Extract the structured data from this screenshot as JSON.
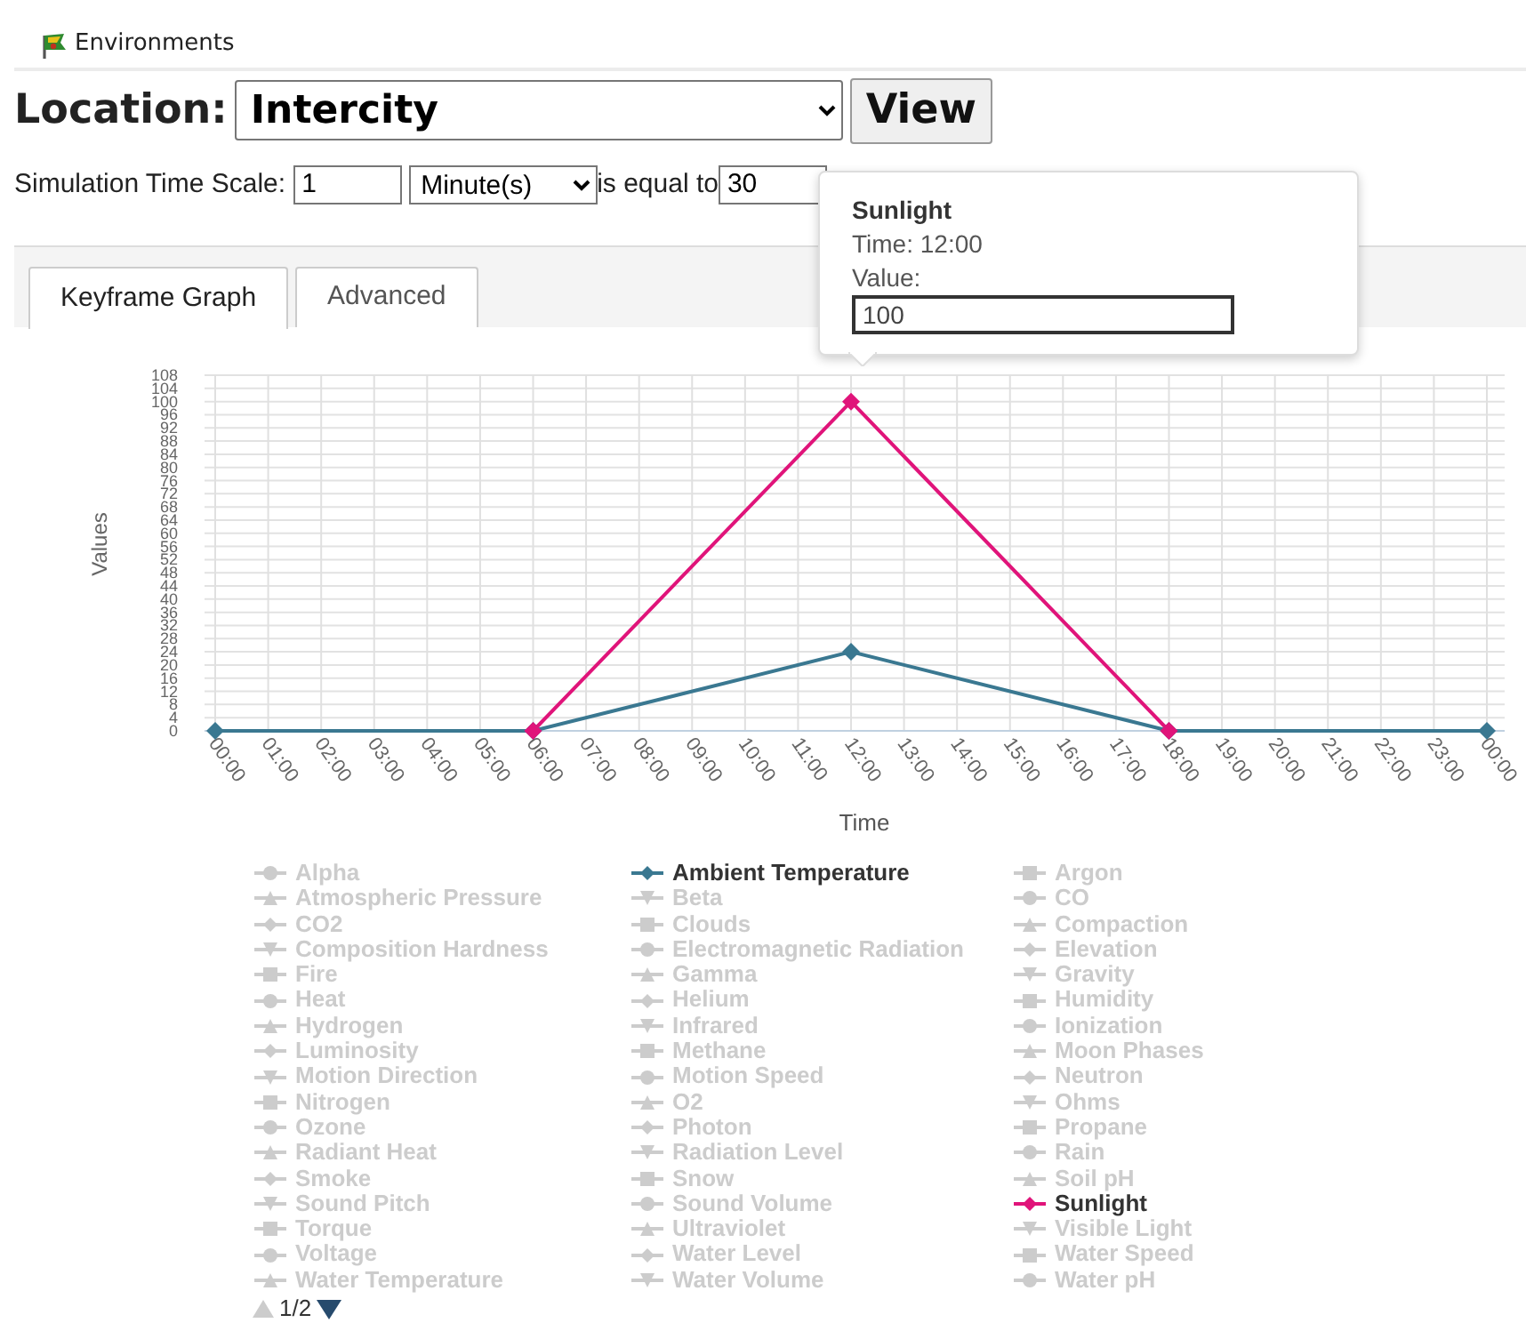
{
  "header": {
    "title": "Environments"
  },
  "location": {
    "label": "Location:",
    "value": "Intercity",
    "button": "View"
  },
  "time_scale": {
    "label": "Simulation Time Scale:",
    "amount": "1",
    "unit": "Minute(s)",
    "equals_label": "is equal to",
    "equals_value": "30"
  },
  "tabs": [
    {
      "label": "Keyframe Graph",
      "selected": true
    },
    {
      "label": "Advanced",
      "selected": false
    }
  ],
  "chart": {
    "chart_data": {
      "type": "line",
      "xlabel": "Time",
      "ylabel": "Values",
      "x": [
        0,
        6,
        12,
        18,
        24
      ],
      "grid": true,
      "series": [
        {
          "color": "#3a7891",
          "marker": "diamond",
          "values": [
            0,
            0,
            24,
            0,
            0
          ]
        },
        {
          "color": "#e0147a",
          "marker": "diamond",
          "values": [
            null,
            0,
            100,
            0,
            null
          ]
        }
      ],
      "xlim": [
        0,
        24
      ],
      "ylim": [
        0,
        108
      ],
      "xticks": [
        {
          "value": 0,
          "label": "00:00"
        },
        {
          "value": 1,
          "label": "01:00"
        },
        {
          "value": 2,
          "label": "02:00"
        },
        {
          "value": 3,
          "label": "03:00"
        },
        {
          "value": 4,
          "label": "04:00"
        },
        {
          "value": 5,
          "label": "05:00"
        },
        {
          "value": 6,
          "label": "06:00"
        },
        {
          "value": 7,
          "label": "07:00"
        },
        {
          "value": 8,
          "label": "08:00"
        },
        {
          "value": 9,
          "label": "09:00"
        },
        {
          "value": 10,
          "label": "10:00"
        },
        {
          "value": 11,
          "label": "11:00"
        },
        {
          "value": 12,
          "label": "12:00"
        },
        {
          "value": 13,
          "label": "13:00"
        },
        {
          "value": 14,
          "label": "14:00"
        },
        {
          "value": 15,
          "label": "15:00"
        },
        {
          "value": 16,
          "label": "16:00"
        },
        {
          "value": 17,
          "label": "17:00"
        },
        {
          "value": 18,
          "label": "18:00"
        },
        {
          "value": 19,
          "label": "19:00"
        },
        {
          "value": 20,
          "label": "20:00"
        },
        {
          "value": 21,
          "label": "21:00"
        },
        {
          "value": 22,
          "label": "22:00"
        },
        {
          "value": 23,
          "label": "23:00"
        },
        {
          "value": 24,
          "label": "00:00"
        }
      ],
      "yticks": [
        0,
        4,
        8,
        12,
        16,
        20,
        24,
        28,
        32,
        36,
        40,
        44,
        48,
        52,
        56,
        60,
        64,
        68,
        72,
        76,
        80,
        84,
        88,
        92,
        96,
        100,
        104,
        108
      ]
    }
  },
  "tooltip": {
    "title": "Sunlight",
    "time": "Time: 12:00",
    "value_label": "Value:",
    "value": "100"
  },
  "legend": {
    "items": [
      {
        "name": "Alpha",
        "kind": "circle",
        "visible": false
      },
      {
        "name": "Ambient Temperature",
        "kind": "diamond",
        "visible": true,
        "color": "#3a7891"
      },
      {
        "name": "Argon",
        "kind": "square",
        "visible": false
      },
      {
        "name": "Atmospheric Pressure",
        "kind": "triangle",
        "visible": false
      },
      {
        "name": "Beta",
        "kind": "triangledown",
        "visible": false
      },
      {
        "name": "CO",
        "kind": "circle",
        "visible": false
      },
      {
        "name": "CO2",
        "kind": "diamond",
        "visible": false
      },
      {
        "name": "Clouds",
        "kind": "square",
        "visible": false
      },
      {
        "name": "Compaction",
        "kind": "triangle",
        "visible": false
      },
      {
        "name": "Composition Hardness",
        "kind": "triangledown",
        "visible": false
      },
      {
        "name": "Electromagnetic Radiation",
        "kind": "circle",
        "visible": false
      },
      {
        "name": "Elevation",
        "kind": "diamond",
        "visible": false
      },
      {
        "name": "Fire",
        "kind": "square",
        "visible": false
      },
      {
        "name": "Gamma",
        "kind": "triangle",
        "visible": false
      },
      {
        "name": "Gravity",
        "kind": "triangledown",
        "visible": false
      },
      {
        "name": "Heat",
        "kind": "circle",
        "visible": false
      },
      {
        "name": "Helium",
        "kind": "diamond",
        "visible": false
      },
      {
        "name": "Humidity",
        "kind": "square",
        "visible": false
      },
      {
        "name": "Hydrogen",
        "kind": "triangle",
        "visible": false
      },
      {
        "name": "Infrared",
        "kind": "triangledown",
        "visible": false
      },
      {
        "name": "Ionization",
        "kind": "circle",
        "visible": false
      },
      {
        "name": "Luminosity",
        "kind": "diamond",
        "visible": false
      },
      {
        "name": "Methane",
        "kind": "square",
        "visible": false
      },
      {
        "name": "Moon Phases",
        "kind": "triangle",
        "visible": false
      },
      {
        "name": "Motion Direction",
        "kind": "triangledown",
        "visible": false
      },
      {
        "name": "Motion Speed",
        "kind": "circle",
        "visible": false
      },
      {
        "name": "Neutron",
        "kind": "diamond",
        "visible": false
      },
      {
        "name": "Nitrogen",
        "kind": "square",
        "visible": false
      },
      {
        "name": "O2",
        "kind": "triangle",
        "visible": false
      },
      {
        "name": "Ohms",
        "kind": "triangledown",
        "visible": false
      },
      {
        "name": "Ozone",
        "kind": "circle",
        "visible": false
      },
      {
        "name": "Photon",
        "kind": "diamond",
        "visible": false
      },
      {
        "name": "Propane",
        "kind": "square",
        "visible": false
      },
      {
        "name": "Radiant Heat",
        "kind": "triangle",
        "visible": false
      },
      {
        "name": "Radiation Level",
        "kind": "triangledown",
        "visible": false
      },
      {
        "name": "Rain",
        "kind": "circle",
        "visible": false
      },
      {
        "name": "Smoke",
        "kind": "diamond",
        "visible": false
      },
      {
        "name": "Snow",
        "kind": "square",
        "visible": false
      },
      {
        "name": "Soil pH",
        "kind": "triangle",
        "visible": false
      },
      {
        "name": "Sound Pitch",
        "kind": "triangledown",
        "visible": false
      },
      {
        "name": "Sound Volume",
        "kind": "circle",
        "visible": false
      },
      {
        "name": "Sunlight",
        "kind": "diamond",
        "visible": true,
        "color": "#e0147a"
      },
      {
        "name": "Torque",
        "kind": "square",
        "visible": false
      },
      {
        "name": "Ultraviolet",
        "kind": "triangle",
        "visible": false
      },
      {
        "name": "Visible Light",
        "kind": "triangledown",
        "visible": false
      },
      {
        "name": "Voltage",
        "kind": "circle",
        "visible": false
      },
      {
        "name": "Water Level",
        "kind": "diamond",
        "visible": false
      },
      {
        "name": "Water Speed",
        "kind": "square",
        "visible": false
      },
      {
        "name": "Water Temperature",
        "kind": "triangle",
        "visible": false
      },
      {
        "name": "Water Volume",
        "kind": "triangledown",
        "visible": false
      },
      {
        "name": "Water pH",
        "kind": "circle",
        "visible": false
      }
    ],
    "pager": {
      "text": "1/2",
      "can_prev": false,
      "can_next": true
    }
  }
}
